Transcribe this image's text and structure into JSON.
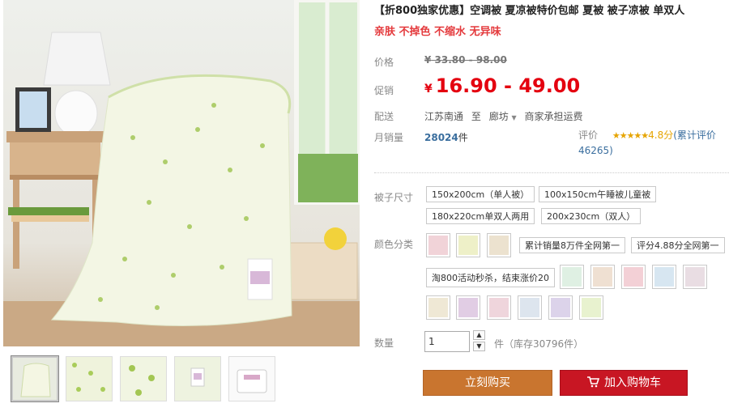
{
  "product": {
    "title": "【折800独家优惠】空调被 夏凉被特价包邮 夏被 被子凉被 单双人",
    "subtitle": "亲肤 不掉色 不缩水 无异味"
  },
  "labels": {
    "original_price": "价格",
    "promo_price": "促销",
    "delivery": "配送",
    "monthly_sales": "月销量",
    "rating": "评价",
    "size": "被子尺寸",
    "color": "颜色分类",
    "quantity": "数量"
  },
  "price": {
    "currency": "¥",
    "original": "33.80 - 98.00",
    "promo": "16.90 - 49.00"
  },
  "delivery": {
    "from": "江苏南通",
    "to_word": "至",
    "to": "廊坊",
    "fee": "商家承担运费"
  },
  "sales": {
    "count": "28024",
    "unit": "件"
  },
  "rating": {
    "stars": "★★★★★",
    "score": "4.8分",
    "link": "(累计评价46265)"
  },
  "sizes": [
    "150x200cm（单人被）",
    "100x150cm午睡被儿童被",
    "180x220cm单双人两用",
    "200x230cm（双人）"
  ],
  "color_text_options": [
    "累计销量8万件全网第一",
    "评分4.88分全网第一",
    "淘800活动秒杀，结束涨价20"
  ],
  "swatch_colors": [
    "#f1d3d8",
    "#eef0c8",
    "#ece2cf",
    "#dff0e3",
    "#efe0d2",
    "#f3d0d6",
    "#d7e6f1",
    "#e9dde3",
    "#efe8d5",
    "#e1cde4",
    "#efd5dc",
    "#dde5ee",
    "#dcd3ea",
    "#e8f2cf",
    "#f2d6da"
  ],
  "quantity": {
    "value": "1",
    "stock": "件（库存30796件）"
  },
  "buttons": {
    "buy": "立刻购买",
    "cart": "加入购物车"
  },
  "icons": {
    "dropdown": "chevron-down-icon",
    "cart": "cart-icon",
    "stepper_up": "triangle-up-icon",
    "stepper_down": "triangle-down-icon"
  },
  "colors": {
    "accent_red": "#e4000f",
    "buy_button": "#c9752f",
    "cart_button": "#c81623",
    "link_blue": "#3a6e9e"
  }
}
